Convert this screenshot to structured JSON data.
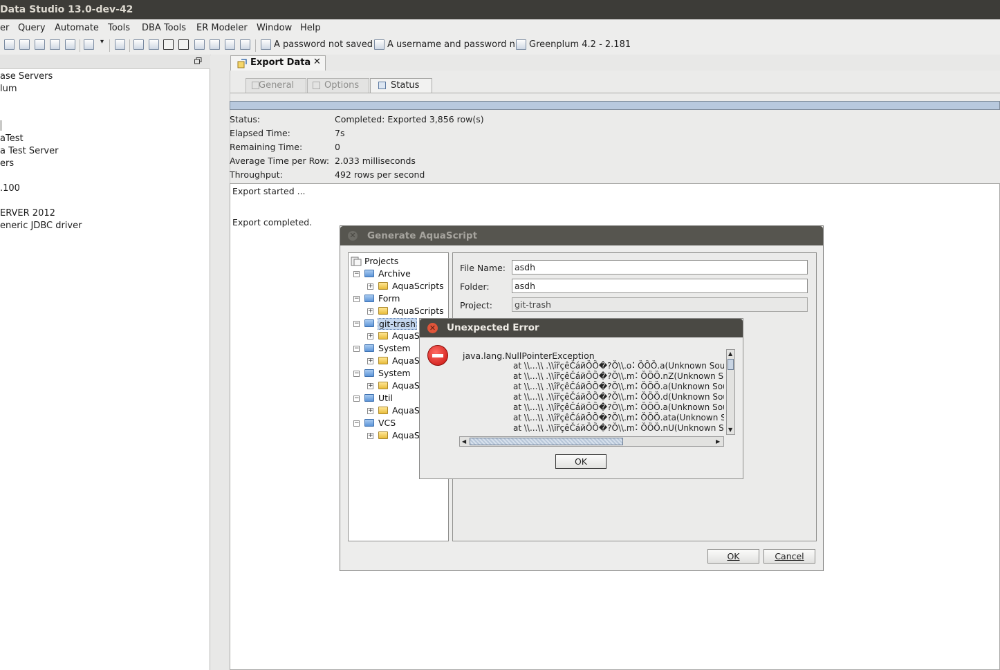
{
  "window": {
    "title": "Data Studio 13.0-dev-42"
  },
  "menu": [
    "er",
    "Query",
    "Automate",
    "Tools",
    "DBA Tools",
    "ER Modeler",
    "Window",
    "Help"
  ],
  "toolbar": {
    "server_warnings": [
      "A password not saved",
      "A username and password n",
      "Greenplum 4.2 - 2.181"
    ]
  },
  "left_panel": {
    "items": [
      "ase Servers",
      "lum",
      "aTest",
      "a Test Server",
      "ers",
      ".100",
      "ERVER 2012",
      "eneric JDBC driver"
    ]
  },
  "main_tab": {
    "label": "Export Data",
    "close": "✕"
  },
  "subtabs": [
    "General",
    "Options",
    "Status"
  ],
  "progress": {
    "fraction": 1.0
  },
  "status": {
    "labels": [
      "Status:",
      "Elapsed Time:",
      "Remaining Time:",
      "Average Time per Row:",
      "Throughput:"
    ],
    "values": [
      "Completed: Exported 3,856 row(s)",
      "7s",
      "0",
      "2.033 milliseconds",
      "492 rows per second"
    ]
  },
  "log": [
    "Export started ...",
    "Export completed."
  ],
  "generate_dialog": {
    "title": "Generate AquaScript",
    "tree": {
      "root": "Projects",
      "nodes": [
        {
          "label": "Archive",
          "child": "AquaScripts"
        },
        {
          "label": "Form",
          "child": "AquaScripts"
        },
        {
          "label": "git-trash",
          "child": "AquaS"
        },
        {
          "label": "System",
          "child": "AquaS"
        },
        {
          "label": "System",
          "child": "AquaS"
        },
        {
          "label": "Util",
          "child": "AquaS"
        },
        {
          "label": "VCS",
          "child": "AquaS"
        }
      ]
    },
    "fields": {
      "file_name_label": "File Name:",
      "file_name": "asdh",
      "folder_label": "Folder:",
      "folder": "asdh",
      "project_label": "Project:",
      "project": "git-trash"
    },
    "ok": "OK",
    "cancel": "Cancel"
  },
  "error_dialog": {
    "title": "Unexpected Error",
    "message": "java.lang.NullPointerException",
    "trace": [
      "at \\\\...\\\\ .\\\\ȋȑçêČáйȌȌ�?Ȍ\\\\.o⠅ȌȌȌ.a(Unknown Sou",
      "at \\\\...\\\\ .\\\\ȋȑçêČáйȌȌ�?Ȍ\\\\.m⠅ȌȌȌ.nZ(Unknown S",
      "at \\\\...\\\\ .\\\\ȋȑçêČáйȌȌ�?Ȍ\\\\.m⠅ȌȌȌ.a(Unknown Sou",
      "at \\\\...\\\\ .\\\\ȋȑçêČáйȌȌ�?Ȍ\\\\.m⠅ȌȌȌ.d(Unknown Sou",
      "at \\\\...\\\\ .\\\\ȋȑçêČáйȌȌ�?Ȍ\\\\.m⠅ȌȌȌ.a(Unknown Sou",
      "at \\\\...\\\\ .\\\\ȋȑçêČáйȌȌ�?Ȍ\\\\.m⠅ȌȌȌ.ata(Unknown S",
      "at \\\\...\\\\ .\\\\ȋȑçêČáйȌȌ�?Ȍ\\\\.m⠅ȌȌȌ.nU(Unknown S"
    ],
    "ok": "OK"
  },
  "colors": {
    "progress_fill": "#b8c9de",
    "selection": "#c3d6ee",
    "error_red": "#c8100d"
  }
}
